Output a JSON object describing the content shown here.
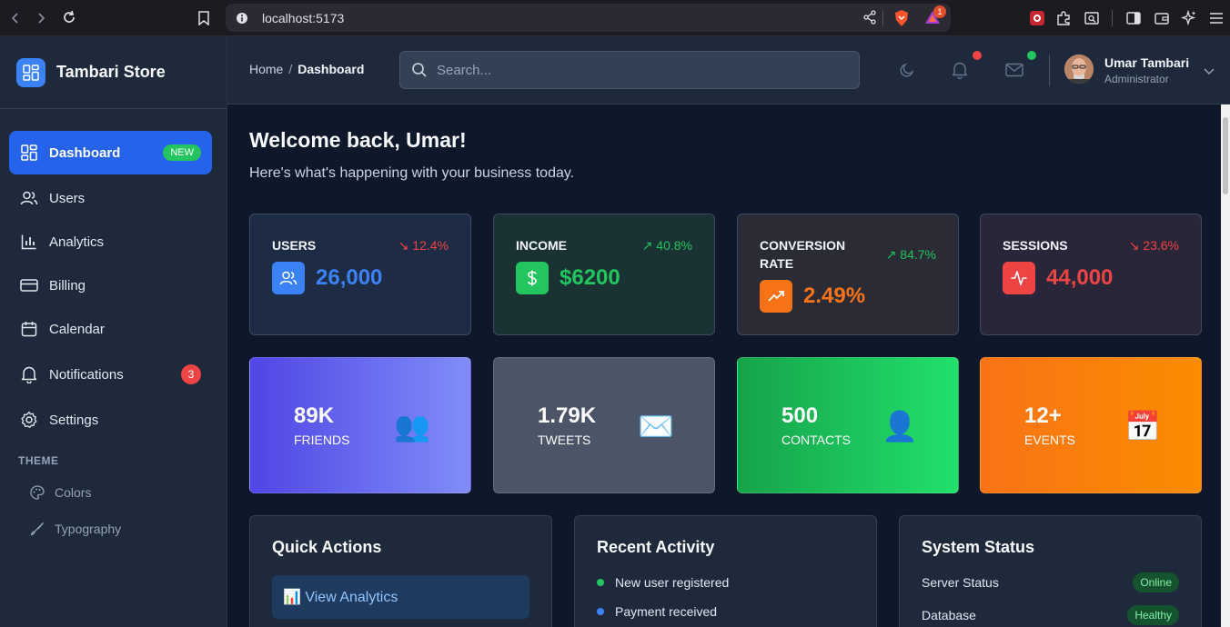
{
  "browser": {
    "url": "localhost:5173",
    "extension_badge": "1"
  },
  "sidebar": {
    "brand": "Tambari Store",
    "items": [
      {
        "label": "Dashboard",
        "badge": "NEW",
        "icon": "grid-icon",
        "active": true
      },
      {
        "label": "Users",
        "icon": "users-icon"
      },
      {
        "label": "Analytics",
        "icon": "bar-chart-icon"
      },
      {
        "label": "Billing",
        "icon": "credit-card-icon"
      },
      {
        "label": "Calendar",
        "icon": "calendar-icon"
      },
      {
        "label": "Notifications",
        "badge": "3",
        "icon": "bell-icon"
      },
      {
        "label": "Settings",
        "icon": "gear-icon"
      }
    ],
    "theme_title": "THEME",
    "theme_items": [
      {
        "label": "Colors",
        "icon": "palette-icon"
      },
      {
        "label": "Typography",
        "icon": "brush-icon"
      }
    ]
  },
  "header": {
    "breadcrumb_home": "Home",
    "breadcrumb_sep": "/",
    "breadcrumb_current": "Dashboard",
    "search_placeholder": "Search...",
    "user_name": "Umar Tambari",
    "user_role": "Administrator"
  },
  "main": {
    "welcome": "Welcome back, Umar!",
    "subtitle": "Here's what's happening with your business today.",
    "stats": [
      {
        "label": "USERS",
        "change": "12.4%",
        "direction": "down",
        "value": "26,000",
        "color": "#3b82f6"
      },
      {
        "label": "INCOME",
        "change": "40.8%",
        "direction": "up",
        "value": "$6200",
        "color": "#22c55e"
      },
      {
        "label": "CONVERSION RATE",
        "change": "84.7%",
        "direction": "up",
        "value": "2.49%",
        "color": "#f97316"
      },
      {
        "label": "SESSIONS",
        "change": "23.6%",
        "direction": "down",
        "value": "44,000",
        "color": "#ef4444"
      }
    ],
    "tiles": [
      {
        "number": "89K",
        "label": "FRIENDS",
        "emoji": "👥"
      },
      {
        "number": "1.79K",
        "label": "TWEETS",
        "emoji": "✉️"
      },
      {
        "number": "500",
        "label": "CONTACTS",
        "emoji": "👤"
      },
      {
        "number": "12+",
        "label": "EVENTS",
        "emoji": "📅"
      }
    ],
    "quick_actions": {
      "title": "Quick Actions",
      "button": "📊 View Analytics"
    },
    "recent_activity": {
      "title": "Recent Activity",
      "items": [
        {
          "text": "New user registered",
          "color": "#22c55e"
        },
        {
          "text": "Payment received",
          "color": "#3b82f6"
        }
      ]
    },
    "system_status": {
      "title": "System Status",
      "rows": [
        {
          "label": "Server Status",
          "status": "Online"
        },
        {
          "label": "Database",
          "status": "Healthy"
        }
      ]
    }
  }
}
